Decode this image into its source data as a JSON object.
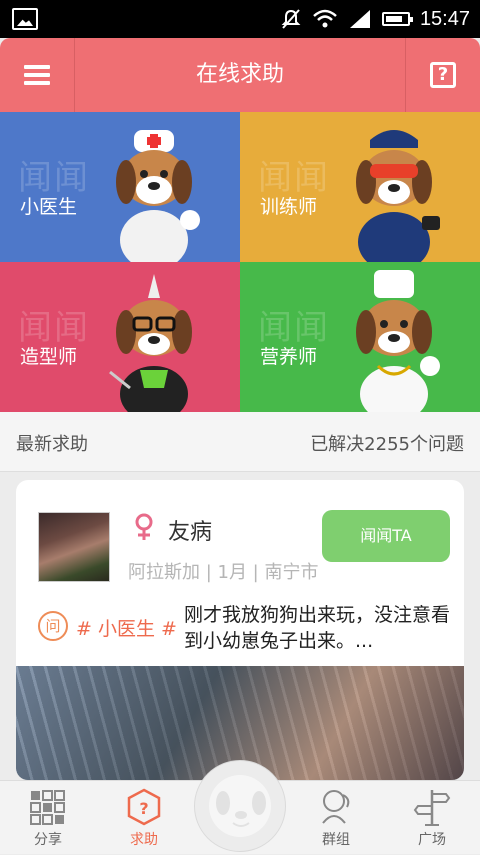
{
  "status_bar": {
    "time": "15:47"
  },
  "header": {
    "title": "在线求助"
  },
  "tiles": [
    {
      "watermark": "闻闻",
      "label": "小医生",
      "color": "#4e78c9"
    },
    {
      "watermark": "闻闻",
      "label": "训练师",
      "color": "#e7ac3b"
    },
    {
      "watermark": "闻闻",
      "label": "造型师",
      "color": "#e04b6b"
    },
    {
      "watermark": "闻闻",
      "label": "营养师",
      "color": "#47b94a"
    }
  ],
  "section": {
    "title": "最新求助",
    "solved": "已解决2255个问题"
  },
  "post": {
    "username": "友病",
    "meta": "阿拉斯加 | 1月 | 南宁市",
    "action_label": "闻闻TA",
    "question_icon": "问",
    "tag": "# 小医生 #",
    "text": "刚才我放狗狗出来玩，没注意看到小幼崽兔子出来。..."
  },
  "tabbar": {
    "items": [
      {
        "label": "分享",
        "icon": "grid-icon"
      },
      {
        "label": "求助",
        "icon": "help-box-icon"
      },
      {
        "label": "群组",
        "icon": "group-icon"
      },
      {
        "label": "广场",
        "icon": "signpost-icon"
      }
    ],
    "active": "求助"
  },
  "colors": {
    "accent": "#ef6f73",
    "action_green": "#7fcf6f",
    "tag_orange": "#ee6a4d"
  }
}
